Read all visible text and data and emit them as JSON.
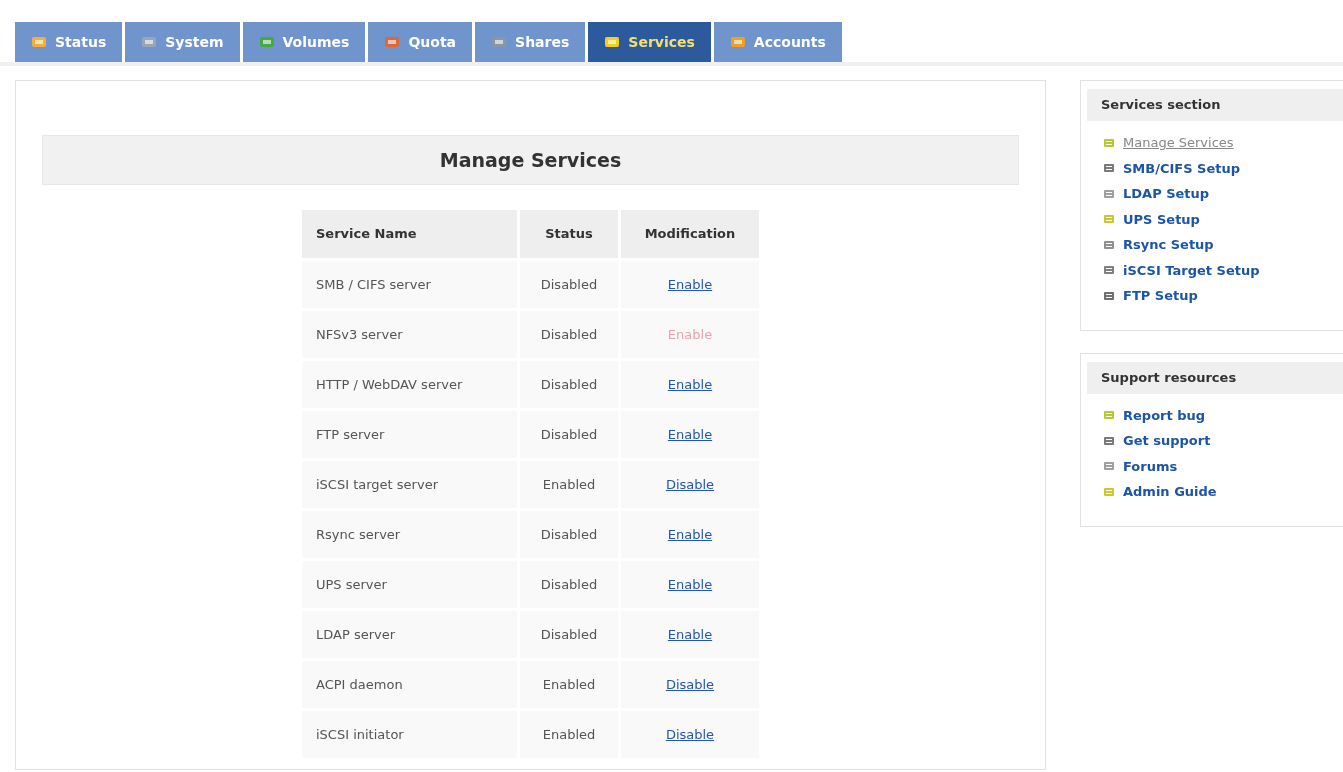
{
  "tabs": [
    {
      "label": "Status",
      "selected": false
    },
    {
      "label": "System",
      "selected": false
    },
    {
      "label": "Volumes",
      "selected": false
    },
    {
      "label": "Quota",
      "selected": false
    },
    {
      "label": "Shares",
      "selected": false
    },
    {
      "label": "Services",
      "selected": true
    },
    {
      "label": "Accounts",
      "selected": false
    }
  ],
  "main": {
    "title": "Manage Services",
    "table": {
      "columns": [
        "Service Name",
        "Status",
        "Modification"
      ],
      "rows": [
        {
          "name": "SMB / CIFS server",
          "status": "Disabled",
          "action": "Enable",
          "disabled": false
        },
        {
          "name": "NFSv3 server",
          "status": "Disabled",
          "action": "Enable",
          "disabled": true
        },
        {
          "name": "HTTP / WebDAV server",
          "status": "Disabled",
          "action": "Enable",
          "disabled": false
        },
        {
          "name": "FTP server",
          "status": "Disabled",
          "action": "Enable",
          "disabled": false
        },
        {
          "name": "iSCSI target server",
          "status": "Enabled",
          "action": "Disable",
          "disabled": false
        },
        {
          "name": "Rsync server",
          "status": "Disabled",
          "action": "Enable",
          "disabled": false
        },
        {
          "name": "UPS server",
          "status": "Disabled",
          "action": "Enable",
          "disabled": false
        },
        {
          "name": "LDAP server",
          "status": "Disabled",
          "action": "Enable",
          "disabled": false
        },
        {
          "name": "ACPI daemon",
          "status": "Enabled",
          "action": "Disable",
          "disabled": false
        },
        {
          "name": "iSCSI initiator",
          "status": "Enabled",
          "action": "Disable",
          "disabled": false
        }
      ]
    }
  },
  "sidebar": [
    {
      "title": "Services section",
      "items": [
        {
          "label": "Manage Services",
          "selected": true
        },
        {
          "label": "SMB/CIFS Setup",
          "selected": false
        },
        {
          "label": "LDAP Setup",
          "selected": false
        },
        {
          "label": "UPS Setup",
          "selected": false
        },
        {
          "label": "Rsync Setup",
          "selected": false
        },
        {
          "label": "iSCSI Target Setup",
          "selected": false
        },
        {
          "label": "FTP Setup",
          "selected": false
        }
      ]
    },
    {
      "title": "Support resources",
      "items": [
        {
          "label": "Report bug",
          "selected": false
        },
        {
          "label": "Get support",
          "selected": false
        },
        {
          "label": "Forums",
          "selected": false
        },
        {
          "label": "Admin Guide",
          "selected": false
        }
      ]
    }
  ]
}
